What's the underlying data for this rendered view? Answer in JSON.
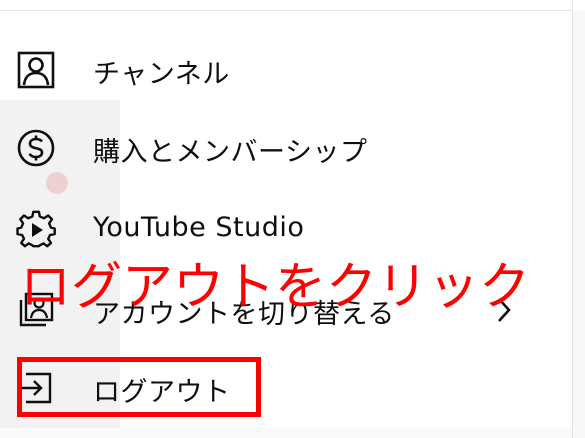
{
  "menu": {
    "items": [
      {
        "label": "チャンネル",
        "icon": "person-box-icon"
      },
      {
        "label": "購入とメンバーシップ",
        "icon": "dollar-circle-icon"
      },
      {
        "label": "YouTube Studio",
        "icon": "studio-gear-play-icon"
      },
      {
        "label": "アカウントを切り替える",
        "icon": "switch-account-icon",
        "chevron": "chevron-right-icon"
      },
      {
        "label": "ログアウト",
        "icon": "sign-out-icon"
      }
    ]
  },
  "annotation": {
    "text": "ログアウトをクリック",
    "color": "#ff0000"
  }
}
